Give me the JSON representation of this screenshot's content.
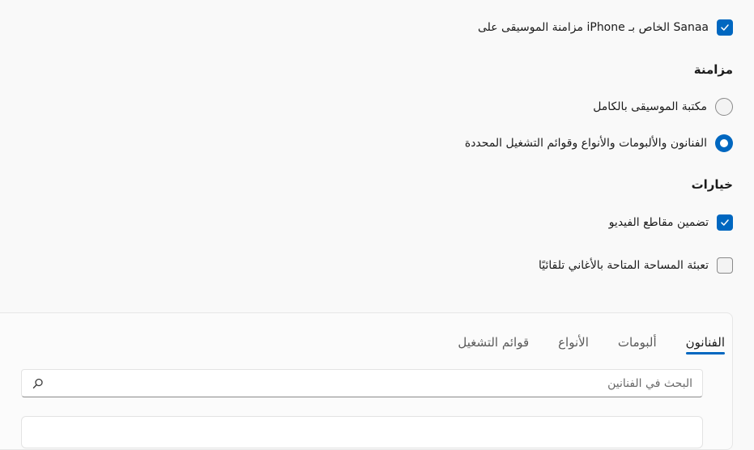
{
  "sync_music": {
    "label": "مزامنة الموسيقى على iPhone الخاص بـ Sanaa",
    "checked": true
  },
  "sync_section": {
    "title": "مزامنة",
    "options": [
      {
        "label": "مكتبة الموسيقى بالكامل",
        "selected": false
      },
      {
        "label": "الفنانون والألبومات والأنواع وقوائم التشغيل المحددة",
        "selected": true
      }
    ]
  },
  "options_section": {
    "title": "خيارات",
    "include_videos": {
      "label": "تضمين مقاطع الفيديو",
      "checked": true
    },
    "autofill": {
      "label": "تعبئة المساحة المتاحة بالأغاني تلقائيًا",
      "checked": false
    }
  },
  "tabs": [
    {
      "label": "الفنانون",
      "active": true
    },
    {
      "label": "ألبومات",
      "active": false
    },
    {
      "label": "الأنواع",
      "active": false
    },
    {
      "label": "قوائم التشغيل",
      "active": false
    }
  ],
  "search": {
    "placeholder": "البحث في الفنانين",
    "icon": "search-icon"
  },
  "colors": {
    "accent": "#0067c0"
  }
}
